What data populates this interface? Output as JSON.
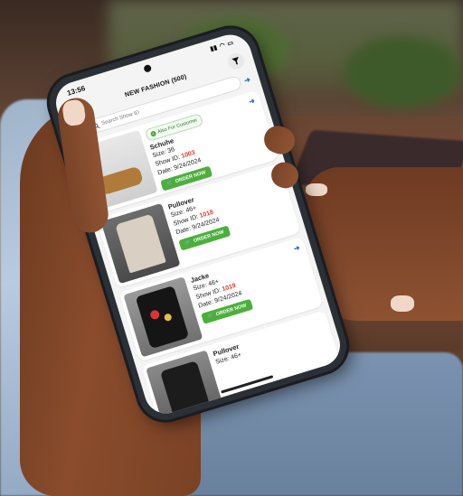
{
  "status": {
    "time": "13:56"
  },
  "header": {
    "title": "NEW FASHION (500)"
  },
  "search": {
    "placeholder": "Search Show ID"
  },
  "items": [
    {
      "tag": "Also For Customer",
      "name": "Schuhe",
      "size": "Size: 36",
      "show_label": "Show ID:",
      "show_id": "1003",
      "date": "Date: 9/24/2024",
      "button": "ORDER NOW"
    },
    {
      "name": "Pullover",
      "size": "Size: 46+",
      "show_label": "Show ID:",
      "show_id": "1018",
      "date": "Date: 9/24/2024",
      "button": "ORDER NOW"
    },
    {
      "name": "Jacke",
      "size": "Size: 46+",
      "show_label": "Show ID:",
      "show_id": "1019",
      "date": "Date: 9/24/2024",
      "button": "ORDER NOW"
    },
    {
      "name": "Pullover",
      "size": "Size: 46+"
    }
  ],
  "icons": {
    "filter": "filter-icon",
    "back": "chevron-left-icon",
    "search": "search-icon",
    "cart": "cart-icon",
    "arrow": "arrow-right-icon",
    "check": "check-icon"
  },
  "colors": {
    "accent_green": "#4caf3c",
    "id_red": "#e03b2f",
    "arrow_blue": "#2d6bd6"
  }
}
